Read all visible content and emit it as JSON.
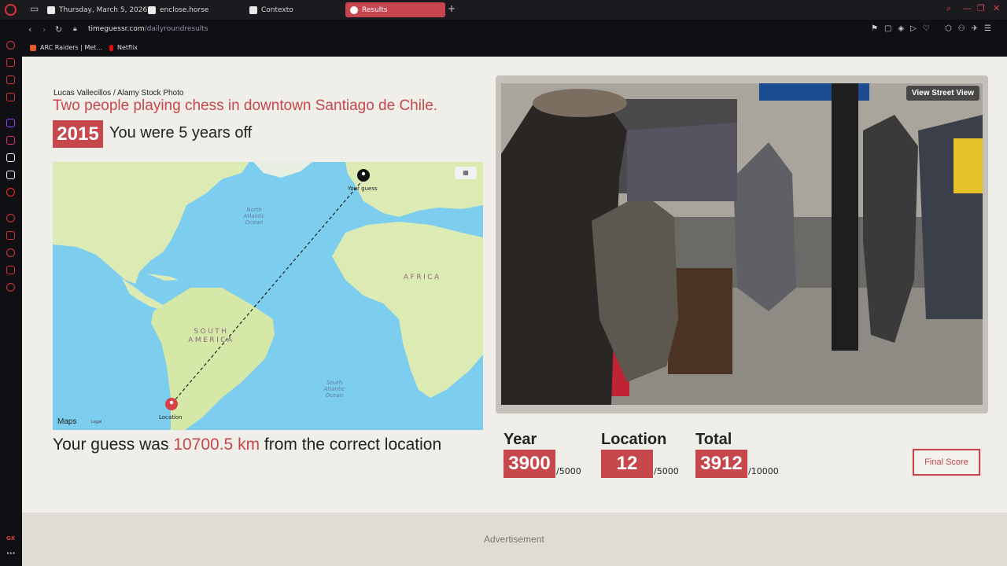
{
  "browser": {
    "tabs": [
      {
        "label": "Thursday, March 5, 2026"
      },
      {
        "label": "enclose.horse"
      },
      {
        "label": "Contexto"
      },
      {
        "label": "Results"
      }
    ],
    "url_domain": "timeguessr.com",
    "url_path": "/dailyroundresults",
    "bookmarks": [
      {
        "label": "ARC Raiders | Met..."
      },
      {
        "label": "Netflix"
      }
    ],
    "sidebar_bottom_label": "GX"
  },
  "result": {
    "credit": "Lucas Vallecillos / Alamy Stock Photo",
    "title": "Two people playing chess in downtown Santiago de Chile.",
    "year": "2015",
    "years_off_text": "You were 5 years off"
  },
  "map": {
    "ocean_labels": [
      "North Atlantic Ocean",
      "South Atlantic Ocean"
    ],
    "continent_labels": [
      "AFRICA",
      "SOUTH AMERICA"
    ],
    "guess_label": "Your guess",
    "location_label": "Location",
    "maps_logo": "Maps",
    "legal": "Legal"
  },
  "distance": {
    "prefix": "Your guess was ",
    "value": "10700.5 km",
    "suffix": " from the correct location"
  },
  "photo": {
    "street_view_label": "View Street View"
  },
  "scores": {
    "year": {
      "label": "Year",
      "value": "3900",
      "max": "/5000"
    },
    "location": {
      "label": "Location",
      "value": "12",
      "max": "/5000"
    },
    "total": {
      "label": "Total",
      "value": "3912",
      "max": "/10000"
    }
  },
  "final_score_label": "Final Score",
  "advertisement_label": "Advertisement",
  "colors": {
    "accent": "#c6474c",
    "page_bg": "#efeee8",
    "chrome_bg": "#101014"
  }
}
